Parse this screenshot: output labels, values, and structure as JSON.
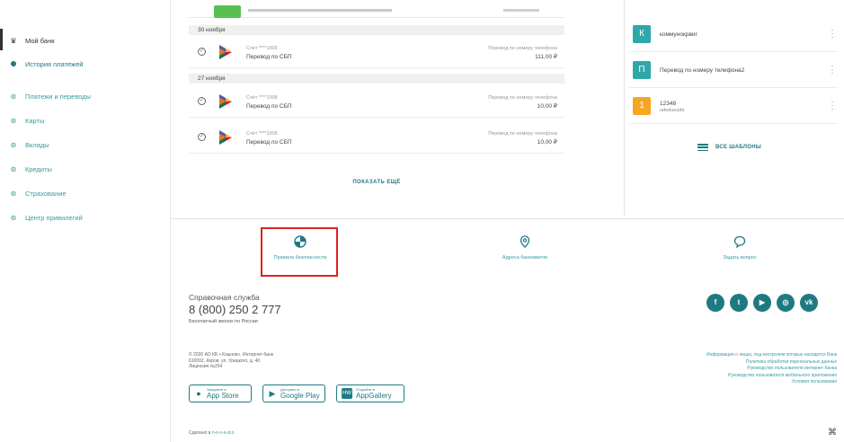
{
  "sidebar": {
    "items": [
      {
        "label": "Мой банк",
        "icon": "bank-icon"
      },
      {
        "label": "История платежей",
        "icon": "dot-icon"
      },
      {
        "label": "Платежи и переводы",
        "icon": "circle-icon"
      },
      {
        "label": "Карты",
        "icon": "circle-icon"
      },
      {
        "label": "Вклады",
        "icon": "circle-icon"
      },
      {
        "label": "Кредиты",
        "icon": "circle-icon"
      },
      {
        "label": "Страхование",
        "icon": "circle-icon"
      },
      {
        "label": "Центр привилегий",
        "icon": "circle-icon"
      }
    ]
  },
  "history": {
    "groups": [
      {
        "date": "30 ноября",
        "items": [
          {
            "account": "Счёт ****1008",
            "title": "Перевод по СБП",
            "kind": "Перевод по номеру телефона",
            "amount": "111,00 ₽"
          }
        ]
      },
      {
        "date": "27 ноября",
        "items": [
          {
            "account": "Счёт ****1008",
            "title": "Перевод по СБП",
            "kind": "Перевод по номеру телефона",
            "amount": "10,00 ₽"
          },
          {
            "account": "Счёт ****1008",
            "title": "Перевод по СБП",
            "kind": "Перевод по номеру телефона",
            "amount": "10,00 ₽"
          }
        ]
      }
    ],
    "show_more": "ПОКАЗАТЬ ЕЩЁ"
  },
  "templates": {
    "items": [
      {
        "letter": "К",
        "name": "коммунокрвиг",
        "sub": "",
        "color": "#2ea8a8"
      },
      {
        "letter": "П",
        "name": "Перевод по номеру телефона2",
        "sub": "",
        "color": "#2ea8a8"
      },
      {
        "letter": "1",
        "name": "12348",
        "sub": "udedueude",
        "color": "#f5a623"
      }
    ],
    "all_label": "ВСЕ ШАБЛОНЫ"
  },
  "footer": {
    "links": [
      {
        "label": "Правила безопасности",
        "icon": "shield-icon"
      },
      {
        "label": "Адреса банкоматов",
        "icon": "location-pin-icon"
      },
      {
        "label": "Задать вопрос",
        "icon": "chat-bubble-icon"
      }
    ],
    "help": {
      "label": "Справочная служба",
      "phone": "8 (800) 250 2 777",
      "note": "Бесплатный звонок по России"
    },
    "socials": [
      {
        "name": "facebook-icon",
        "glyph": "f"
      },
      {
        "name": "twitter-icon",
        "glyph": "t"
      },
      {
        "name": "youtube-icon",
        "glyph": "▶"
      },
      {
        "name": "instagram-icon",
        "glyph": "◎"
      },
      {
        "name": "vk-icon",
        "glyph": "vk"
      }
    ],
    "legal": {
      "line1": "© 2020 АО КБ «Хлынов». Интернет-банк",
      "line2": "610002, Киров, ул. Урицкого, д. 40",
      "line3": "Лицензия №254"
    },
    "right_links": [
      "Информация о лицах, под контролем которых находится Банк",
      "Политика обработки персональных данных",
      "Руководство пользователя интернет-банка",
      "Руководство пользователя мобильного приложения",
      "Условия пользования"
    ],
    "stores": [
      {
        "small": "Загрузите в",
        "big": "App Store",
        "glyph": ""
      },
      {
        "small": "Доступно в",
        "big": "Google Play",
        "glyph": "▶"
      },
      {
        "small": "Откройте в",
        "big": "AppGallery",
        "glyph": "HW"
      }
    ],
    "made_prefix": "Сделано в ",
    "made_link": "n-o-v-e-d.o."
  },
  "colors": {
    "accent": "#1e7a82",
    "highlight": "#e02020",
    "sbp_green": "#58c04f"
  }
}
